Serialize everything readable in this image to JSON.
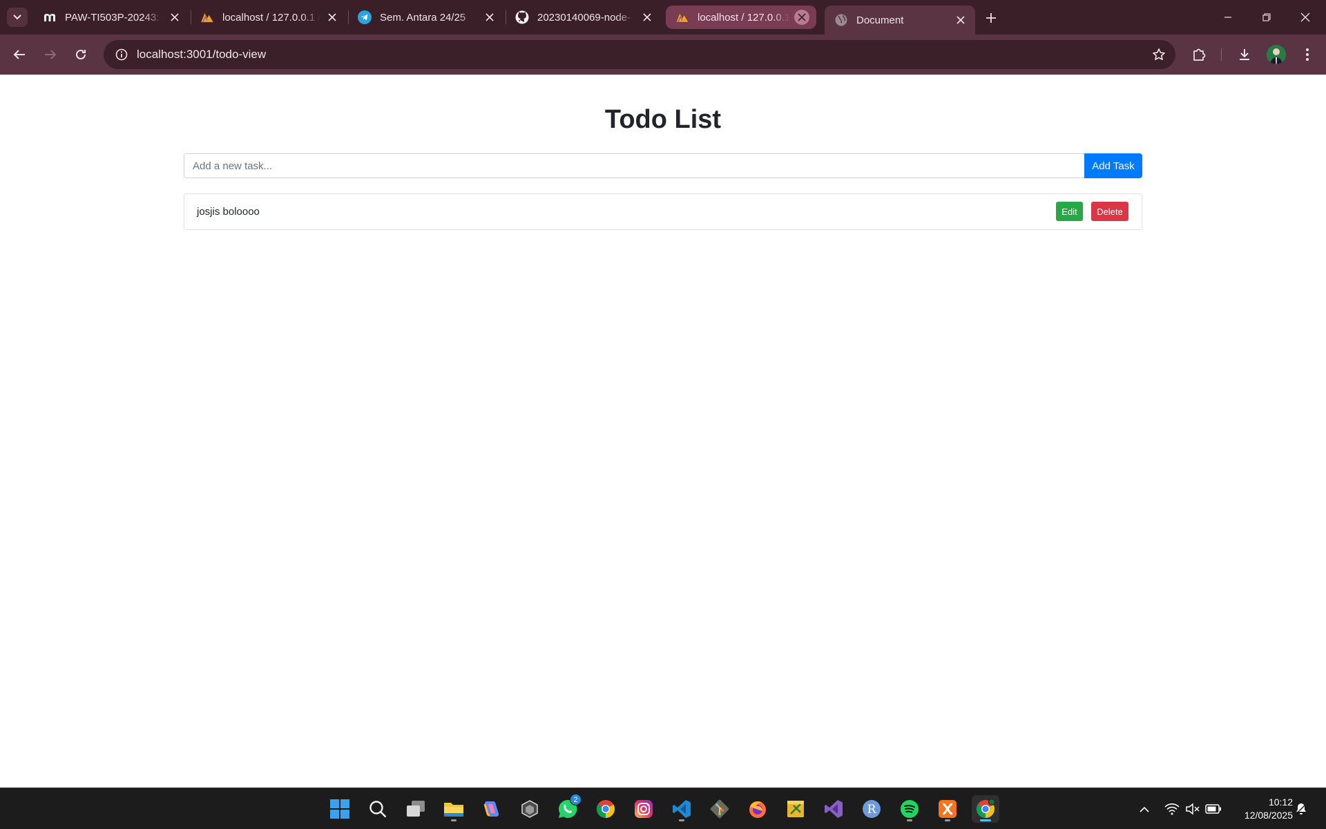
{
  "browser": {
    "tabs": [
      {
        "title": "PAW-TI503P-20243: A",
        "icon": "moodle-icon"
      },
      {
        "title": "localhost / 127.0.0.1 /",
        "icon": "phpmyadmin-icon"
      },
      {
        "title": "Sem. Antara 24/25",
        "icon": "telegram-icon"
      },
      {
        "title": "20230140069-node-",
        "icon": "github-icon"
      },
      {
        "title": "localhost / 127.0.0.1",
        "icon": "phpmyadmin-icon"
      },
      {
        "title": "Document",
        "icon": "globe-icon"
      }
    ],
    "url": "localhost:3001/todo-view"
  },
  "page": {
    "title": "Todo List",
    "input_placeholder": "Add a new task...",
    "add_button": "Add Task",
    "todos": [
      {
        "text": "josjis boloooo",
        "edit_label": "Edit",
        "delete_label": "Delete"
      }
    ]
  },
  "taskbar": {
    "apps": [
      "windows-start-icon",
      "search-icon",
      "task-view-icon",
      "file-explorer-icon",
      "copilot-icon",
      "unity-icon",
      "whatsapp-icon",
      "chrome-icon",
      "instagram-icon",
      "vscode-icon",
      "git-icon",
      "firefox-icon",
      "sticky-notes-icon",
      "visual-studio-icon",
      "r-icon",
      "spotify-icon",
      "xampp-icon",
      "chrome-icon"
    ],
    "whatsapp_badge": "2",
    "time": "10:12",
    "date": "12/08/2025"
  },
  "colors": {
    "tabstrip": "#3a1f28",
    "toolbar": "#5a3442",
    "primary": "#007bff",
    "success": "#28a745",
    "danger": "#dc3545"
  }
}
